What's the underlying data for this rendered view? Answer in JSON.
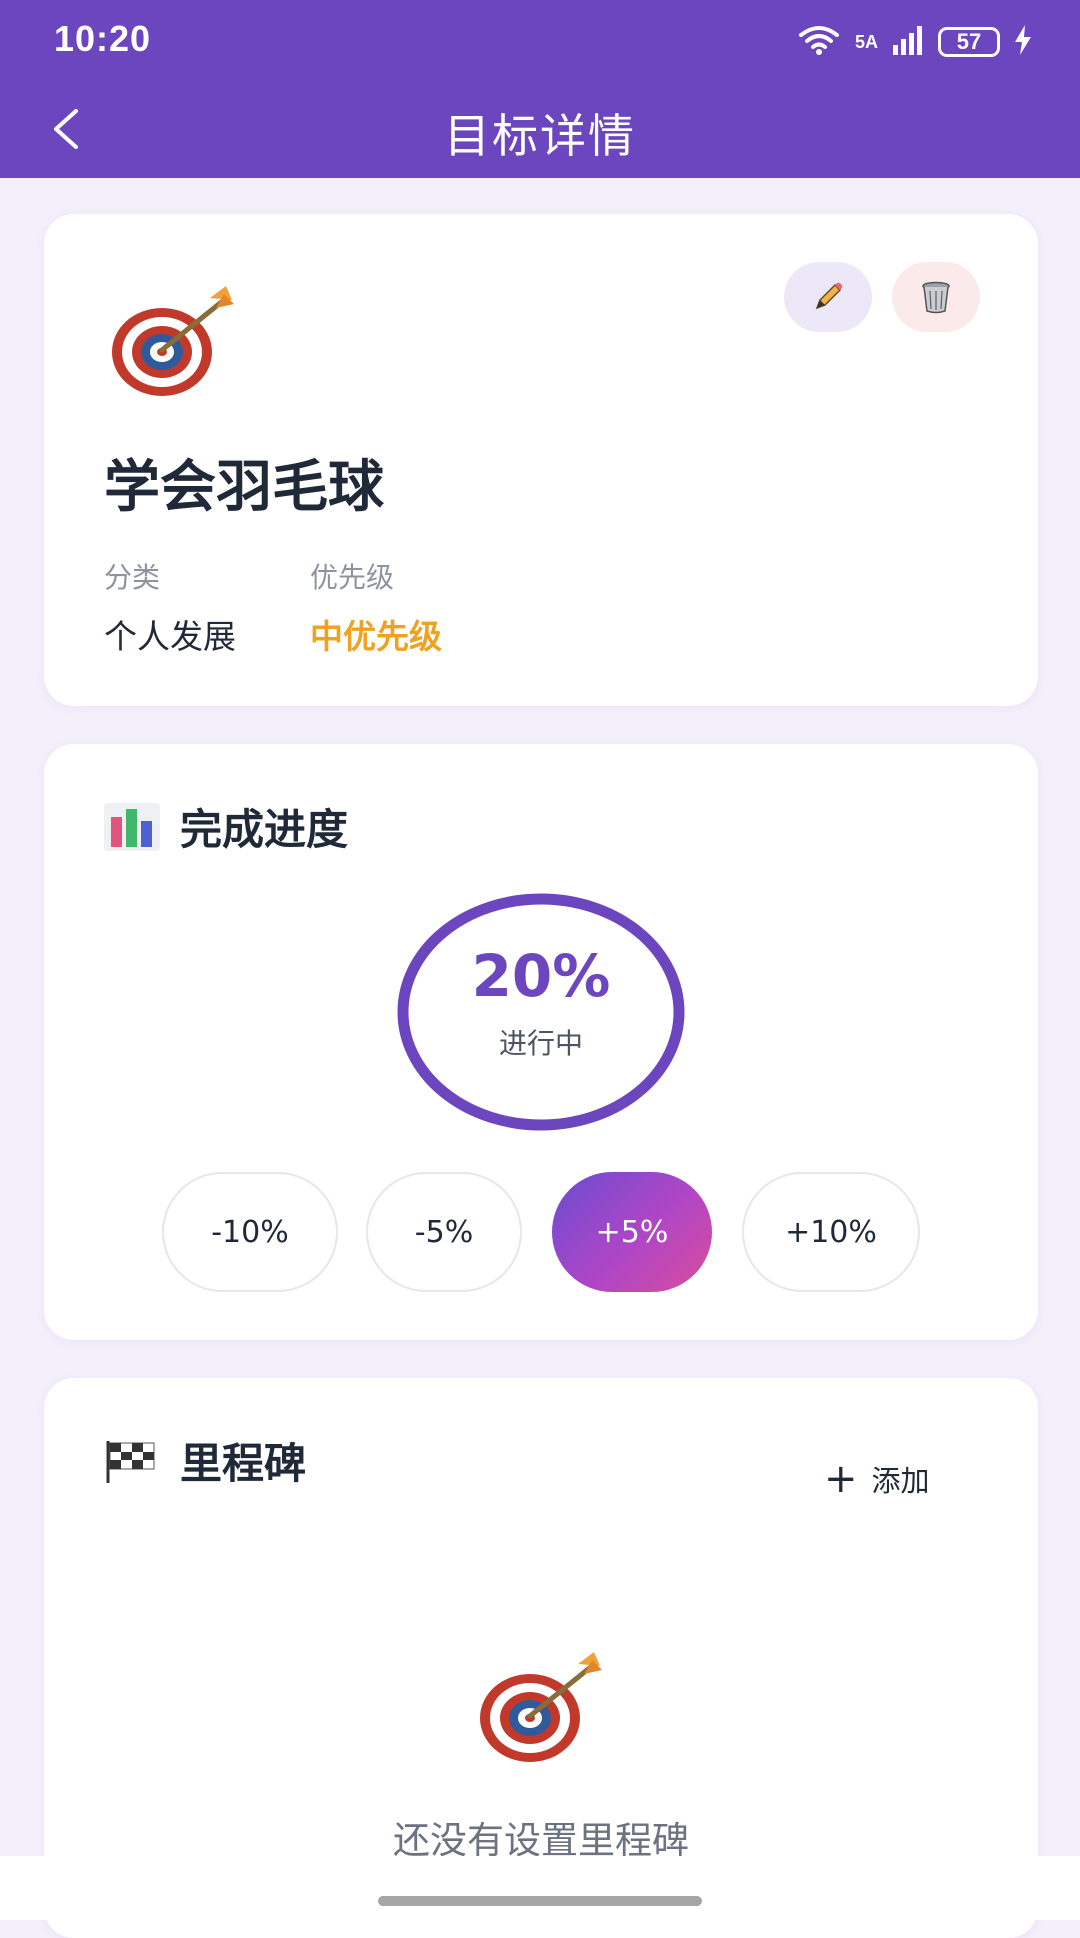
{
  "status_bar": {
    "time": "10:20",
    "network": "5A",
    "battery": "57"
  },
  "app_bar": {
    "title": "目标详情"
  },
  "goal": {
    "title": "学会羽毛球",
    "category_label": "分类",
    "category_value": "个人发展",
    "priority_label": "优先级",
    "priority_value": "中优先级",
    "icon": "dart-target-icon"
  },
  "progress": {
    "section_title": "完成进度",
    "percent": "20%",
    "status": "进行中",
    "buttons": [
      "-10%",
      "-5%",
      "+5%",
      "+10%"
    ]
  },
  "milestones": {
    "section_title": "里程碑",
    "add_label": "添加",
    "empty_text": "还没有设置里程碑"
  },
  "colors": {
    "primary": "#6c46bf",
    "priority": "#eea21f",
    "background": "#f3effb"
  }
}
